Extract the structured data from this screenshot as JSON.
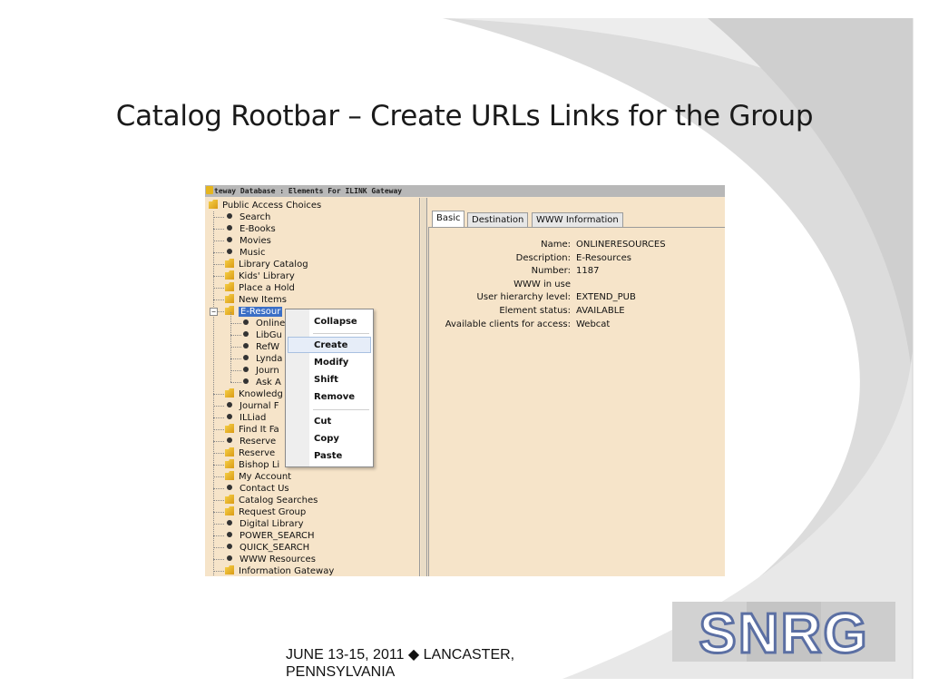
{
  "slide": {
    "title": "Catalog Rootbar – Create URLs Links for the Group",
    "footer": "JUNE 13-15, 2011 ◆ LANCASTER, PENNSYLVANIA",
    "logo_text": "SNRG"
  },
  "window": {
    "title": "teway Database : Elements For ILINK Gateway"
  },
  "tree": {
    "root": "Public Access Choices",
    "items": [
      {
        "label": "Search",
        "type": "bullet",
        "level": 1
      },
      {
        "label": "E-Books",
        "type": "bullet",
        "level": 1
      },
      {
        "label": "Movies",
        "type": "bullet",
        "level": 1
      },
      {
        "label": "Music",
        "type": "bullet",
        "level": 1
      },
      {
        "label": "Library Catalog",
        "type": "folder",
        "level": 1
      },
      {
        "label": "Kids' Library",
        "type": "folder",
        "level": 1
      },
      {
        "label": "Place a Hold",
        "type": "folder",
        "level": 1
      },
      {
        "label": "New Items",
        "type": "folder",
        "level": 1
      },
      {
        "label": "E-Resour",
        "type": "folder",
        "level": 1,
        "selected": true,
        "expanded": true
      },
      {
        "label": "Online",
        "type": "bullet",
        "level": 2
      },
      {
        "label": "LibGu",
        "type": "bullet",
        "level": 2
      },
      {
        "label": "RefW",
        "type": "bullet",
        "level": 2
      },
      {
        "label": "Lynda",
        "type": "bullet",
        "level": 2
      },
      {
        "label": "Journ",
        "type": "bullet",
        "level": 2
      },
      {
        "label": "Ask A",
        "type": "bullet",
        "level": 2
      },
      {
        "label": "Knowledg",
        "type": "folder",
        "level": 1
      },
      {
        "label": "Journal F",
        "type": "bullet",
        "level": 1
      },
      {
        "label": "ILLiad",
        "type": "bullet",
        "level": 1
      },
      {
        "label": "Find It Fa",
        "type": "folder",
        "level": 1
      },
      {
        "label": "Reserve",
        "type": "bullet",
        "level": 1
      },
      {
        "label": "Reserve",
        "type": "folder",
        "level": 1
      },
      {
        "label": "Bishop Li",
        "type": "folder",
        "level": 1
      },
      {
        "label": "My Account",
        "type": "folder",
        "level": 1
      },
      {
        "label": "Contact Us",
        "type": "bullet",
        "level": 1
      },
      {
        "label": "Catalog Searches",
        "type": "folder",
        "level": 1
      },
      {
        "label": "Request Group",
        "type": "folder",
        "level": 1
      },
      {
        "label": "Digital Library",
        "type": "bullet",
        "level": 1
      },
      {
        "label": "POWER_SEARCH",
        "type": "bullet",
        "level": 1
      },
      {
        "label": "QUICK_SEARCH",
        "type": "bullet",
        "level": 1
      },
      {
        "label": "WWW Resources",
        "type": "bullet",
        "level": 1
      },
      {
        "label": "Information Gateway",
        "type": "folder",
        "level": 1
      }
    ]
  },
  "context_menu": {
    "items": [
      "Collapse",
      "Create",
      "Modify",
      "Shift",
      "Remove",
      "Cut",
      "Copy",
      "Paste"
    ],
    "highlighted": "Create"
  },
  "tabs": [
    "Basic",
    "Destination",
    "WWW Information"
  ],
  "active_tab": "Basic",
  "details": [
    {
      "key": "Name:",
      "value": "ONLINERESOURCES"
    },
    {
      "key": "Description:",
      "value": "E-Resources"
    },
    {
      "key": "Number:",
      "value": "1187"
    },
    {
      "key": "WWW in use",
      "value": ""
    },
    {
      "key": "User hierarchy level:",
      "value": "EXTEND_PUB"
    },
    {
      "key": "Element status:",
      "value": "AVAILABLE"
    },
    {
      "key": "Available clients for access:",
      "value": "Webcat"
    }
  ],
  "colors": {
    "panel_bg": "#f6e4c9",
    "selection": "#3b6fc6",
    "folder": "#e5b51f",
    "deco_gray": "#d4d4d4",
    "logo_blue": "#5b6fa3",
    "logo_gray": "#c9c9c9"
  }
}
